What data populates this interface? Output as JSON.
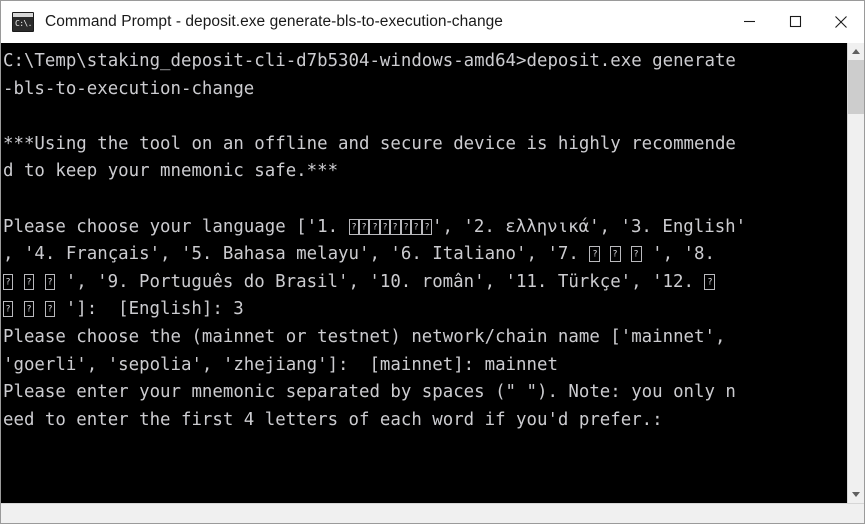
{
  "window": {
    "title": "Command Prompt - deposit.exe  generate-bls-to-execution-change",
    "icon_name": "cmd-icon",
    "icon_glyph": "C:\\.",
    "controls": {
      "minimize_label": "Minimize",
      "maximize_label": "Maximize",
      "close_label": "Close"
    },
    "background": "#000000",
    "foreground": "#ccccd0",
    "titlebar_background": "#ffffff"
  },
  "console": {
    "lines": [
      {
        "id": "l1",
        "text": "C:\\Temp\\staking_deposit-cli-d7b5304-windows-amd64>deposit.exe generate"
      },
      {
        "id": "l2",
        "text": "-bls-to-execution-change"
      },
      {
        "id": "l3",
        "text": ""
      },
      {
        "id": "l4",
        "text": "***Using the tool on an offline and secure device is highly recommende"
      },
      {
        "id": "l5",
        "text": "d to keep your mnemonic safe.***"
      },
      {
        "id": "l6",
        "text": ""
      },
      {
        "id": "l7",
        "prefix": "Please choose your language ['1. ",
        "tofu_count": 8,
        "tofu_spaced": false,
        "suffix": "', '2. ελληνικά', '3. English'"
      },
      {
        "id": "l8",
        "prefix": ", '4. Français', '5. Bahasa melayu', '6. Italiano', '7. ",
        "tofu_count": 3,
        "tofu_spaced": true,
        "suffix": "', '8."
      },
      {
        "id": "l9",
        "prefix": "",
        "tofu_count": 3,
        "tofu_spaced": true,
        "suffix": "', '9. Português do Brasil', '10. român', '11. Türkçe', '12. ",
        "tofu_trailing": 1
      },
      {
        "id": "l10",
        "prefix": "",
        "tofu_count": 3,
        "tofu_spaced": true,
        "suffix": "']:  [English]: 3"
      },
      {
        "id": "l11",
        "text": "Please choose the (mainnet or testnet) network/chain name ['mainnet',"
      },
      {
        "id": "l12",
        "text": "'goerli', 'sepolia', 'zhejiang']:  [mainnet]: mainnet"
      },
      {
        "id": "l13",
        "text": "Please enter your mnemonic separated by spaces (\" \"). Note: you only n"
      },
      {
        "id": "l14",
        "text": "eed to enter the first 4 letters of each word if you'd prefer.:"
      }
    ]
  },
  "scrollbar": {
    "up_arrow_name": "scroll-up-arrow",
    "down_arrow_name": "scroll-down-arrow"
  }
}
